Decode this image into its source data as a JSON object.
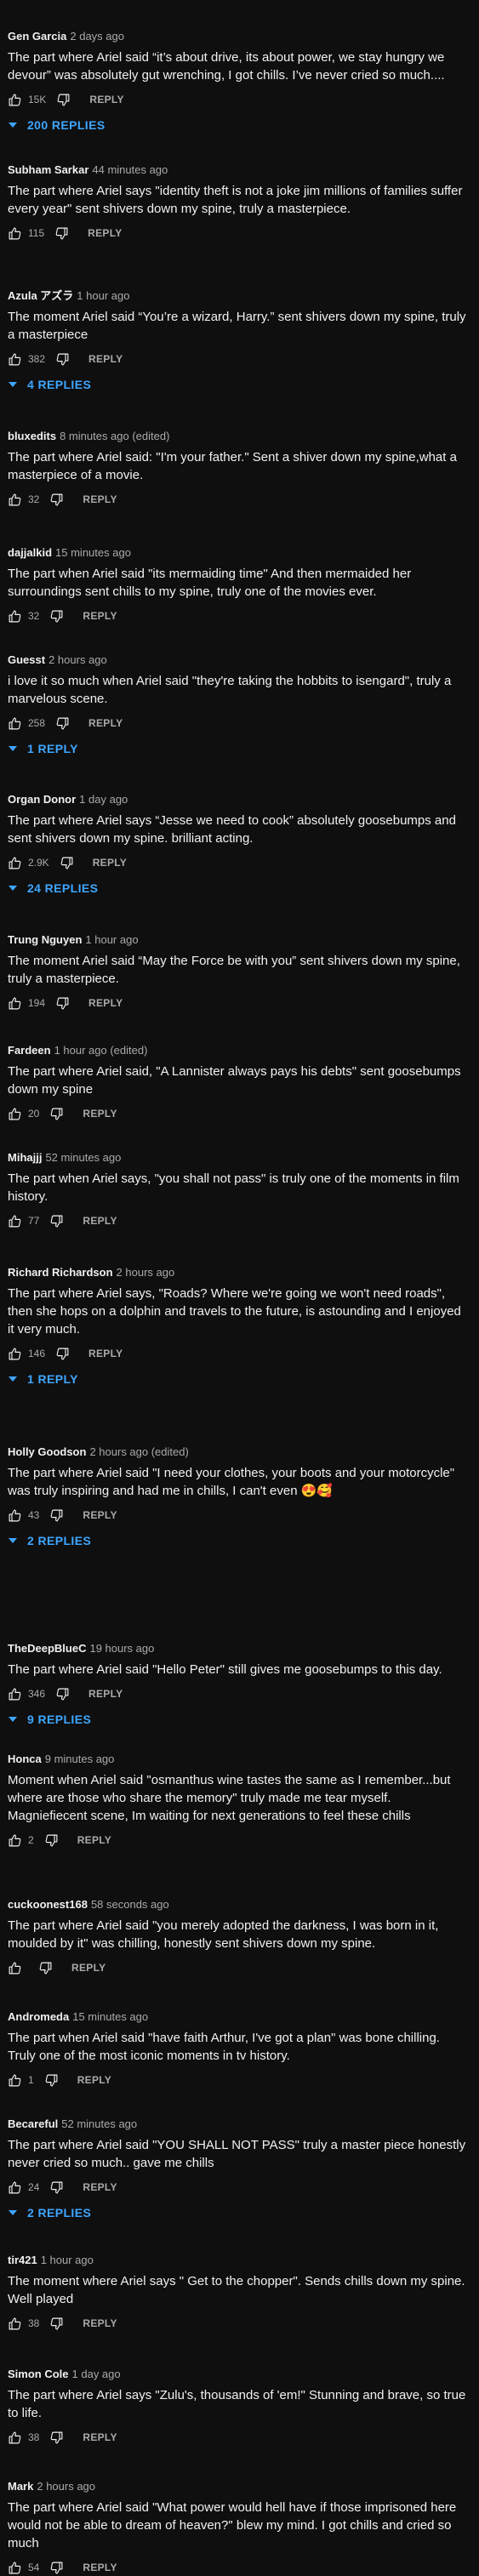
{
  "ui": {
    "reply_label": "REPLY",
    "accent_color": "#3ea6ff",
    "like_icon": "thumb-up-icon",
    "dislike_icon": "thumb-down-icon"
  },
  "comments": [
    {
      "author": "Gen Garcia",
      "time": "2 days ago",
      "text": "The part where Ariel said “it’s about drive, its about power, we stay hungry we devour” was absolutely gut wrenching, I got chills. I’ve never cried so much....",
      "likes": "15K",
      "replies": "200 REPLIES"
    },
    {
      "author": "Subham Sarkar",
      "time": "44 minutes ago",
      "text": "The part where Ariel says \"identity theft is not a joke jim millions of families suffer every year\" sent shivers down my spine, truly a masterpiece.",
      "likes": "115",
      "replies": ""
    },
    {
      "author": "Azula アズラ",
      "time": "1 hour ago",
      "text": "The moment Ariel said “You’re a wizard, Harry.” sent shivers down my spine, truly a masterpiece",
      "likes": "382",
      "replies": "4 REPLIES"
    },
    {
      "author": "bluxedits",
      "time": "8 minutes ago (edited)",
      "text": "The part where Ariel said: \"I'm your father.\" Sent a shiver down my spine,what a masterpiece of a movie.",
      "likes": "32",
      "replies": ""
    },
    {
      "author": "dajjalkid",
      "time": "15 minutes ago",
      "text": "The part when Ariel said \"its mermaiding time\" And then  mermaided her surroundings sent chills to my spine, truly one of the movies ever.",
      "likes": "32",
      "replies": ""
    },
    {
      "author": "Guesst",
      "time": "2 hours ago",
      "text": "i love it so much when Ariel said \"they're taking the hobbits to isengard\", truly a marvelous scene.",
      "likes": "258",
      "replies": "1 REPLY"
    },
    {
      "author": "Organ Donor",
      "time": "1 day ago",
      "text": "The part where Ariel says “Jesse we need to cook” absolutely goosebumps and sent shivers down my spine. brilliant acting.",
      "likes": "2.9K",
      "replies": "24 REPLIES"
    },
    {
      "author": "Trung Nguyen",
      "time": "1 hour ago",
      "text": "The moment Ariel said “May the Force be with you” sent shivers down my spine, truly a masterpiece.",
      "likes": "194",
      "replies": ""
    },
    {
      "author": "Fardeen",
      "time": "1 hour ago (edited)",
      "text": "The part where Ariel said, \"A Lannister always pays his debts\" sent goosebumps down my spine",
      "likes": "20",
      "replies": ""
    },
    {
      "author": "Mihajjj",
      "time": "52 minutes ago",
      "text": "The part when Ariel says, \"you shall not pass\" is truly one of the moments in film history.",
      "likes": "77",
      "replies": ""
    },
    {
      "author": "Richard Richardson",
      "time": "2 hours ago",
      "text": "The part where Ariel says, \"Roads? Where we're going we won't need roads\", then she hops on a dolphin and travels to the future, is astounding and I enjoyed it very much.",
      "likes": "146",
      "replies": "1 REPLY"
    },
    {
      "author": "Holly Goodson",
      "time": "2 hours ago (edited)",
      "text": "The part where Ariel said \"I need your clothes, your boots and your motorcycle\" was truly inspiring and had me in chills, I can't even 😍🥰",
      "likes": "43",
      "replies": "2 REPLIES"
    },
    {
      "author": "TheDeepBlueC",
      "time": "19 hours ago",
      "text": "The part where Ariel said \"Hello Peter\" still gives me goosebumps to this day.",
      "likes": "346",
      "replies": "9 REPLIES"
    },
    {
      "author": "Honca",
      "time": "9 minutes ago",
      "text": "Moment when Ariel said \"osmanthus wine tastes the same as I remember...but where are those who share the memory\" truly made me tear myself. Magniefiecent scene, Im waiting for next generations to feel these chills",
      "likes": "2",
      "replies": ""
    },
    {
      "author": "cuckoonest168",
      "time": "58 seconds ago",
      "text": "The part where Ariel said \"you merely adopted the darkness, I was born in it, moulded by it\" was chilling, honestly sent shivers down my spine.",
      "likes": "",
      "replies": ""
    },
    {
      "author": "Andromeda",
      "time": "15 minutes ago",
      "text": "The part when Ariel said \"have faith Arthur, I've got a plan\" was bone chilling. Truly one of the most iconic moments in tv history.",
      "likes": "1",
      "replies": ""
    },
    {
      "author": "Becareful",
      "time": "52 minutes ago",
      "text": "The part where Ariel said \"YOU SHALL NOT PASS\" truly a master piece honestly never cried so much.. gave me chills",
      "likes": "24",
      "replies": "2 REPLIES"
    },
    {
      "author": "tir421",
      "time": "1 hour ago",
      "text": "The moment where Ariel says \" Get to the chopper\". Sends chills down my spine. Well played",
      "likes": "38",
      "replies": ""
    },
    {
      "author": "Simon Cole",
      "time": "1 day ago",
      "text": "The part where Ariel says \"Zulu's, thousands of 'em!\" Stunning and brave, so true to life.",
      "likes": "38",
      "replies": ""
    },
    {
      "author": "Mark",
      "time": "2 hours ago",
      "text": "The part where Ariel said \"What power would hell have if those imprisoned here would not be able to dream of heaven?\" blew my mind. I got chills and cried so much",
      "likes": "54",
      "replies": ""
    }
  ]
}
